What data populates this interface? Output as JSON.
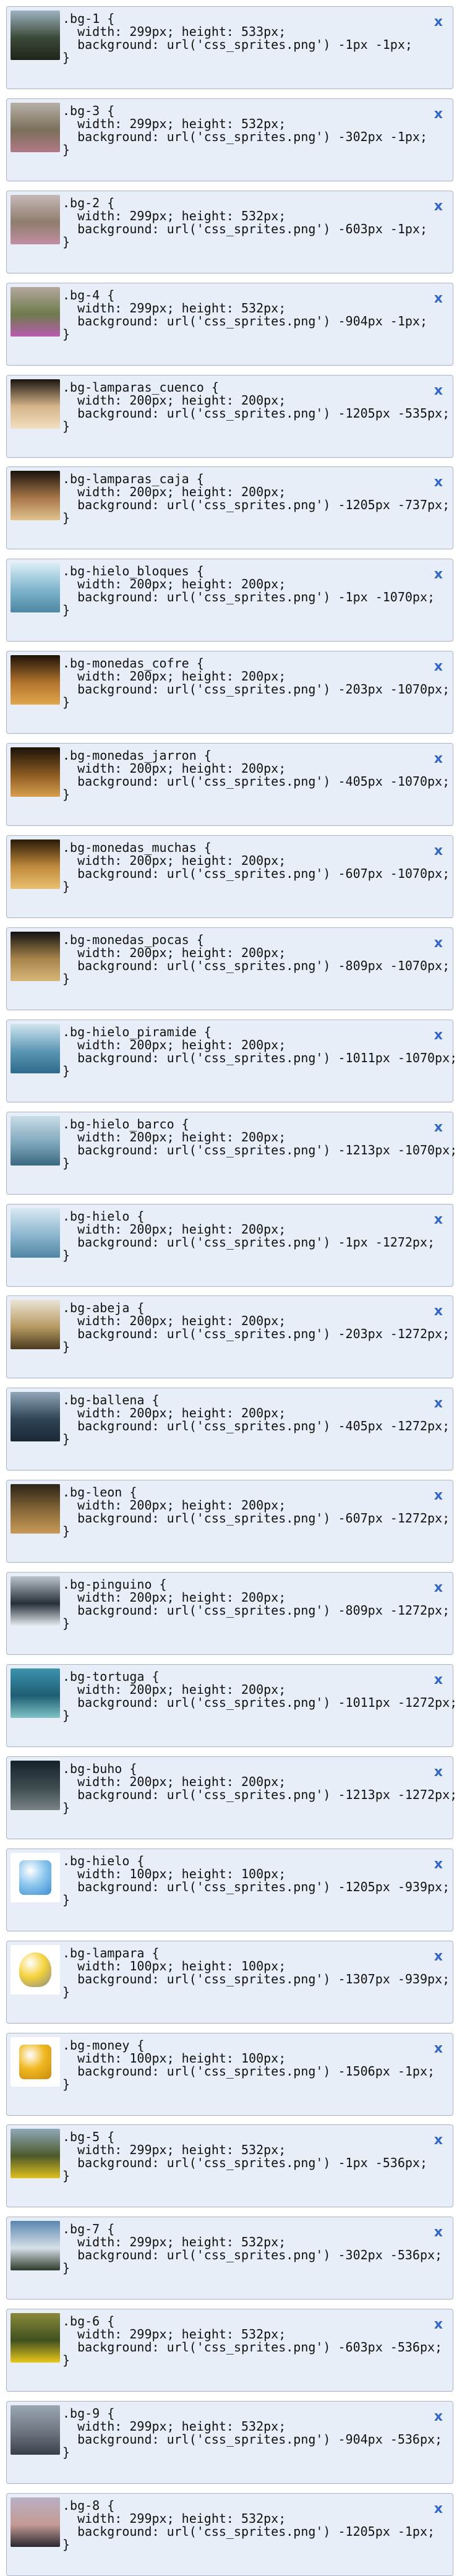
{
  "close_label": "x",
  "items": [
    {
      "selector": ".bg-1 {",
      "line1": "  width: 299px; height: 533px;",
      "line2": "  background: url('css_sprites.png') -1px -1px;",
      "close": "}",
      "thumb": "landscape-field",
      "colors": [
        "#9db3c2",
        "#3c4a38",
        "#1e2418"
      ]
    },
    {
      "selector": ".bg-3 {",
      "line1": "  width: 299px; height: 532px;",
      "line2": "  background: url('css_sprites.png') -302px -1px;",
      "close": "}",
      "thumb": "flower-meadow",
      "colors": [
        "#b6b0a6",
        "#7b6f5a",
        "#b07a86"
      ]
    },
    {
      "selector": ".bg-2 {",
      "line1": "  width: 299px; height: 532px;",
      "line2": "  background: url('css_sprites.png') -603px -1px;",
      "close": "}",
      "thumb": "flower-meadow",
      "colors": [
        "#c7b8b8",
        "#8f7d6e",
        "#c28ea2"
      ]
    },
    {
      "selector": ".bg-4 {",
      "line1": "  width: 299px; height: 532px;",
      "line2": "  background: url('css_sprites.png') -904px -1px;",
      "close": "}",
      "thumb": "thistle-flower",
      "colors": [
        "#b3a89d",
        "#6e7a4c",
        "#b85cae"
      ]
    },
    {
      "selector": ".bg-lamparas_cuenco {",
      "line1": "  width: 200px; height: 200px;",
      "line2": "  background: url('css_sprites.png') -1205px -535px;",
      "close": "}",
      "thumb": "bowl-lamps",
      "colors": [
        "#1a1510",
        "#d6b58a",
        "#f2e0c0"
      ]
    },
    {
      "selector": ".bg-lamparas_caja {",
      "line1": "  width: 200px; height: 200px;",
      "line2": "  background: url('css_sprites.png') -1205px -737px;",
      "close": "}",
      "thumb": "box-lamps",
      "colors": [
        "#1a130c",
        "#a8774a",
        "#e2c28e"
      ]
    },
    {
      "selector": ".bg-hielo_bloques {",
      "line1": "  width: 200px; height: 200px;",
      "line2": "  background: url('css_sprites.png') -1px -1070px;",
      "close": "}",
      "thumb": "ice-blocks",
      "colors": [
        "#d9eef6",
        "#7fb4cc",
        "#4c87a3"
      ]
    },
    {
      "selector": ".bg-monedas_cofre {",
      "line1": "  width: 200px; height: 200px;",
      "line2": "  background: url('css_sprites.png') -203px -1070px;",
      "close": "}",
      "thumb": "coins-chest",
      "colors": [
        "#1c1208",
        "#b2732c",
        "#e2a64e"
      ]
    },
    {
      "selector": ".bg-monedas_jarron {",
      "line1": "  width: 200px; height: 200px;",
      "line2": "  background: url('css_sprites.png') -405px -1070px;",
      "close": "}",
      "thumb": "coins-jar",
      "colors": [
        "#1a1208",
        "#8c5a22",
        "#d8a04c"
      ]
    },
    {
      "selector": ".bg-monedas_muchas {",
      "line1": "  width: 200px; height: 200px;",
      "line2": "  background: url('css_sprites.png') -607px -1070px;",
      "close": "}",
      "thumb": "many-coins",
      "colors": [
        "#2a1a08",
        "#c08a3c",
        "#e8c070"
      ]
    },
    {
      "selector": ".bg-monedas_pocas {",
      "line1": "  width: 200px; height: 200px;",
      "line2": "  background: url('css_sprites.png') -809px -1070px;",
      "close": "}",
      "thumb": "few-coins",
      "colors": [
        "#121212",
        "#a8844a",
        "#d8b67a"
      ]
    },
    {
      "selector": ".bg-hielo_piramide {",
      "line1": "  width: 200px; height: 200px;",
      "line2": "  background: url('css_sprites.png') -1011px -1070px;",
      "close": "}",
      "thumb": "ice-pyramid",
      "colors": [
        "#cfe6ef",
        "#5c97b4",
        "#2e6a8c"
      ]
    },
    {
      "selector": ".bg-hielo_barco {",
      "line1": "  width: 200px; height: 200px;",
      "line2": "  background: url('css_sprites.png') -1213px -1070px;",
      "close": "}",
      "thumb": "ice-boat",
      "colors": [
        "#c8dde8",
        "#7ea6bb",
        "#3b6880"
      ]
    },
    {
      "selector": ".bg-hielo {",
      "line1": "  width: 200px; height: 200px;",
      "line2": "  background: url('css_sprites.png') -1px -1272px;",
      "close": "}",
      "thumb": "ice-cube",
      "colors": [
        "#d6e8f3",
        "#8bb6cf",
        "#4f86a5"
      ]
    },
    {
      "selector": ".bg-abeja {",
      "line1": "  width: 200px; height: 200px;",
      "line2": "  background: url('css_sprites.png') -203px -1272px;",
      "close": "}",
      "thumb": "bee",
      "colors": [
        "#eae4d6",
        "#b79a62",
        "#4a3a1e"
      ]
    },
    {
      "selector": ".bg-ballena {",
      "line1": "  width: 200px; height: 200px;",
      "line2": "  background: url('css_sprites.png') -405px -1272px;",
      "close": "}",
      "thumb": "whale",
      "colors": [
        "#8fa6b8",
        "#2f4557",
        "#1b2734"
      ]
    },
    {
      "selector": ".bg-leon {",
      "line1": "  width: 200px; height: 200px;",
      "line2": "  background: url('css_sprites.png') -607px -1272px;",
      "close": "}",
      "thumb": "lion",
      "colors": [
        "#2c2418",
        "#8c6a3a",
        "#c99a58"
      ]
    },
    {
      "selector": ".bg-pinguino {",
      "line1": "  width: 200px; height: 200px;",
      "line2": "  background: url('css_sprites.png') -809px -1272px;",
      "close": "}",
      "thumb": "penguin",
      "colors": [
        "#b9c4cc",
        "#263038",
        "#e6ebef"
      ]
    },
    {
      "selector": ".bg-tortuga {",
      "line1": "  width: 200px; height: 200px;",
      "line2": "  background: url('css_sprites.png') -1011px -1272px;",
      "close": "}",
      "thumb": "turtle",
      "colors": [
        "#3c93ae",
        "#1e5e74",
        "#7fc4c6"
      ]
    },
    {
      "selector": ".bg-buho {",
      "line1": "  width: 200px; height: 200px;",
      "line2": "  background: url('css_sprites.png') -1213px -1272px;",
      "close": "}",
      "thumb": "owl",
      "colors": [
        "#16222a",
        "#3e4c50",
        "#7a8486"
      ]
    },
    {
      "selector": ".bg-hielo {",
      "line1": "  width: 100px; height: 100px;",
      "line2": "  background: url('css_sprites.png') -1205px -939px;",
      "close": "}",
      "thumb": "ice-cube-icon",
      "colors": [
        "#ffffff",
        "#8fc8ee",
        "#3a8fd0"
      ]
    },
    {
      "selector": ".bg-lampara {",
      "line1": "  width: 100px; height: 100px;",
      "line2": "  background: url('css_sprites.png') -1307px -939px;",
      "close": "}",
      "thumb": "light-bulb-icon",
      "colors": [
        "#ffffff",
        "#f5d23a",
        "#8a8a8a"
      ]
    },
    {
      "selector": ".bg-money {",
      "line1": "  width: 100px; height: 100px;",
      "line2": "  background: url('css_sprites.png') -1506px -1px;",
      "close": "}",
      "thumb": "coin-stack-icon",
      "colors": [
        "#ffffff",
        "#f0b820",
        "#c98a10"
      ]
    },
    {
      "selector": ".bg-5 {",
      "line1": "  width: 299px; height: 532px;",
      "line2": "  background: url('css_sprites.png') -1px -536px;",
      "close": "}",
      "thumb": "yellow-flowers",
      "colors": [
        "#8fa8b8",
        "#4c5a2a",
        "#e0c020"
      ]
    },
    {
      "selector": ".bg-7 {",
      "line1": "  width: 299px; height: 532px;",
      "line2": "  background: url('css_sprites.png') -302px -536px;",
      "close": "}",
      "thumb": "coast-landscape",
      "colors": [
        "#5a86b0",
        "#d6e0e8",
        "#2c3a2a"
      ]
    },
    {
      "selector": ".bg-6 {",
      "line1": "  width: 299px; height: 532px;",
      "line2": "  background: url('css_sprites.png') -603px -536px;",
      "close": "}",
      "thumb": "yellow-flowers",
      "colors": [
        "#8a8a3a",
        "#405020",
        "#e8c818"
      ]
    },
    {
      "selector": ".bg-9 {",
      "line1": "  width: 299px; height: 532px;",
      "line2": "  background: url('css_sprites.png') -904px -536px;",
      "close": "}",
      "thumb": "foggy-landscape",
      "colors": [
        "#9aa6b4",
        "#6c7480",
        "#3a4048"
      ]
    },
    {
      "selector": ".bg-8 {",
      "line1": "  width: 299px; height: 532px;",
      "line2": "  background: url('css_sprites.png') -1205px -1px;",
      "close": "}",
      "thumb": "sunset-landscape",
      "colors": [
        "#b8b0c4",
        "#c49a94",
        "#2a2830"
      ]
    }
  ]
}
